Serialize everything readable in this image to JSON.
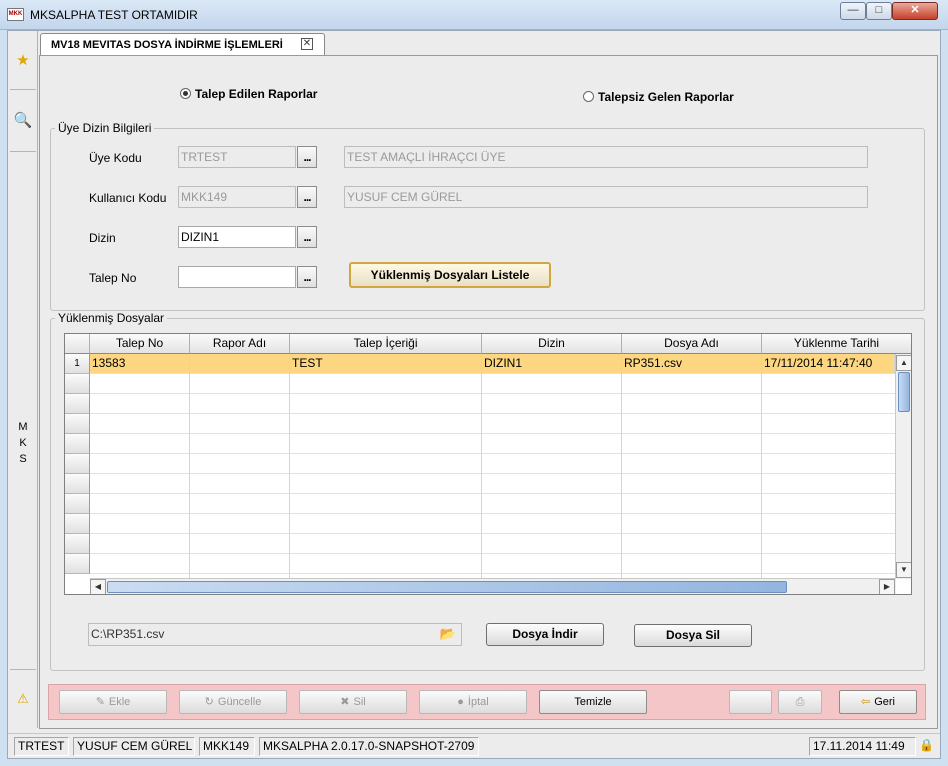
{
  "window": {
    "title": "MKSALPHA TEST ORTAMIDIR",
    "logo_text": "MKK"
  },
  "rail": {
    "vertical_text": [
      "M",
      "K",
      "S"
    ],
    "icons": [
      "star-icon",
      "search-icon",
      "warning-icon"
    ]
  },
  "tab": {
    "label": "MV18 MEVITAS DOSYA İNDİRME İŞLEMLERİ"
  },
  "radios": {
    "option1": "Talep Edilen Raporlar",
    "option2": "Talepsiz Gelen Raporlar",
    "selected": "option1"
  },
  "member_group": {
    "title": "Üye Dizin Bilgileri",
    "uye_kodu_label": "Üye Kodu",
    "uye_kodu_value": "TRTEST",
    "uye_adi_value": "TEST AMAÇLI İHRAÇCI ÜYE",
    "kullanici_kodu_label": "Kullanıcı Kodu",
    "kullanici_kodu_value": "MKK149",
    "kullanici_adi_value": "YUSUF CEM GÜREL",
    "dizin_label": "Dizin",
    "dizin_value": "DIZIN1",
    "talep_no_label": "Talep No",
    "talep_no_value": "",
    "list_button": "Yüklenmiş Dosyaları Listele",
    "dots": "..."
  },
  "files_group": {
    "title": "Yüklenmiş Dosyalar",
    "columns": [
      "Talep No",
      "Rapor Adı",
      "Talep İçeriği",
      "Dizin",
      "Dosya Adı",
      "Yüklenme Tarihi"
    ],
    "rows": [
      [
        "13583",
        "",
        "TEST",
        "DIZIN1",
        "RP351.csv",
        "17/11/2014 11:47:40"
      ]
    ],
    "row_number": "1",
    "file_path": "C:\\RP351.csv",
    "download_button": "Dosya İndir",
    "delete_button": "Dosya Sil"
  },
  "actions": {
    "ekle": "Ekle",
    "guncelle": "Güncelle",
    "sil": "Sil",
    "iptal": "İptal",
    "temizle": "Temizle",
    "geri": "Geri"
  },
  "status": {
    "member": "TRTEST",
    "user": "YUSUF CEM GÜREL",
    "user_code": "MKK149",
    "version": "MKSALPHA 2.0.17.0-SNAPSHOT-2709",
    "datetime": "17.11.2014 11:49"
  },
  "colors": {
    "selected_row": "#fcd680",
    "action_bar": "#f4c6c7",
    "primary_button_border": "#d0a640"
  }
}
